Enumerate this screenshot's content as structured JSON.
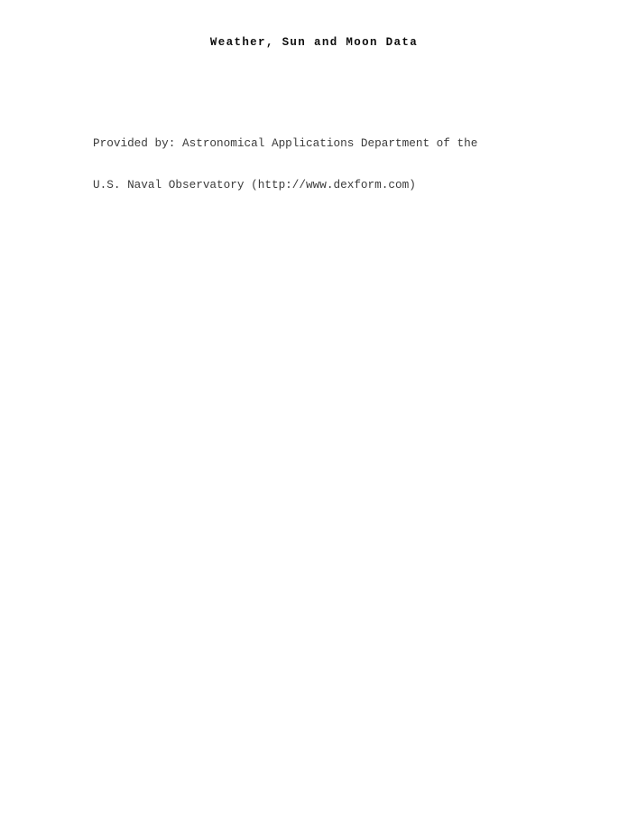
{
  "document": {
    "title": "Weather, Sun and Moon Data",
    "provided_by": {
      "line1": "Provided by: Astronomical Applications Department of the",
      "line2": "U.S. Naval Observatory (http://www.dexform.com)"
    }
  },
  "colors": {
    "page_background": "#ffffff",
    "title_text": "#0e0e0e",
    "body_text": "#3b3b3b"
  }
}
